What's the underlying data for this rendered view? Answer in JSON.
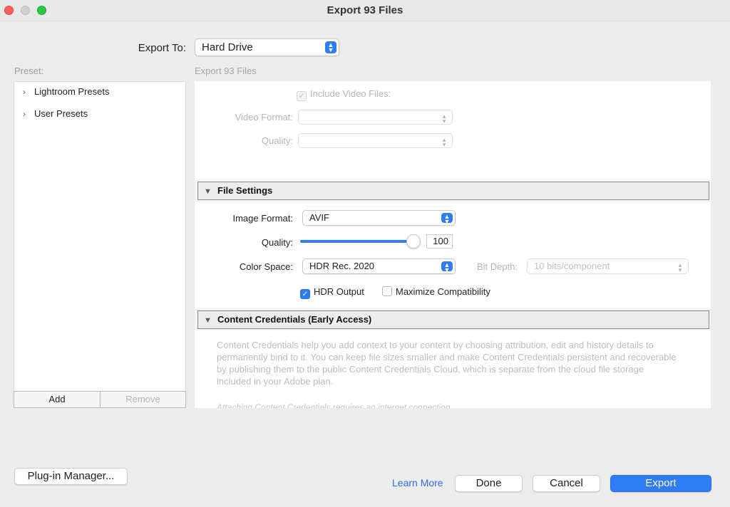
{
  "window": {
    "title": "Export 93 Files"
  },
  "export_to": {
    "label": "Export To:",
    "value": "Hard Drive"
  },
  "preset": {
    "label": "Preset:",
    "items": [
      {
        "label": "Lightroom Presets"
      },
      {
        "label": "User Presets"
      }
    ],
    "add_label": "Add",
    "remove_label": "Remove"
  },
  "section_label": "Export 93 Files",
  "video": {
    "include_label": "Include Video Files:",
    "include_checked": true,
    "format_label": "Video Format:",
    "format_value": "",
    "quality_label": "Quality:",
    "quality_value": ""
  },
  "file_settings": {
    "header": "File Settings",
    "image_format_label": "Image Format:",
    "image_format_value": "AVIF",
    "quality_label": "Quality:",
    "quality_value": "100",
    "quality_fraction": 1.0,
    "color_space_label": "Color Space:",
    "color_space_value": "HDR Rec. 2020",
    "bit_depth_label": "Bit Depth:",
    "bit_depth_value": "10 bits/component",
    "hdr_output_label": "HDR Output",
    "hdr_output_checked": true,
    "max_compat_label": "Maximize Compatibility",
    "max_compat_checked": false
  },
  "content_credentials": {
    "header": "Content Credentials (Early Access)",
    "description": "Content Credentials help you add context to your content by choosing attribution, edit and history details to permanently bind to it. You can keep file sizes smaller and make Content Credentials persistent and recoverable by publishing them to the public Content Credentials Cloud, which is separate from the cloud file storage included in your Adobe plan.",
    "note": "Attaching Content Credentials requires an internet connection."
  },
  "footer": {
    "plugin_manager_label": "Plug-in Manager...",
    "learn_more_label": "Learn More",
    "done_label": "Done",
    "cancel_label": "Cancel",
    "export_label": "Export"
  },
  "colors": {
    "accent": "#2f7df6",
    "link": "#2f6ce0"
  }
}
